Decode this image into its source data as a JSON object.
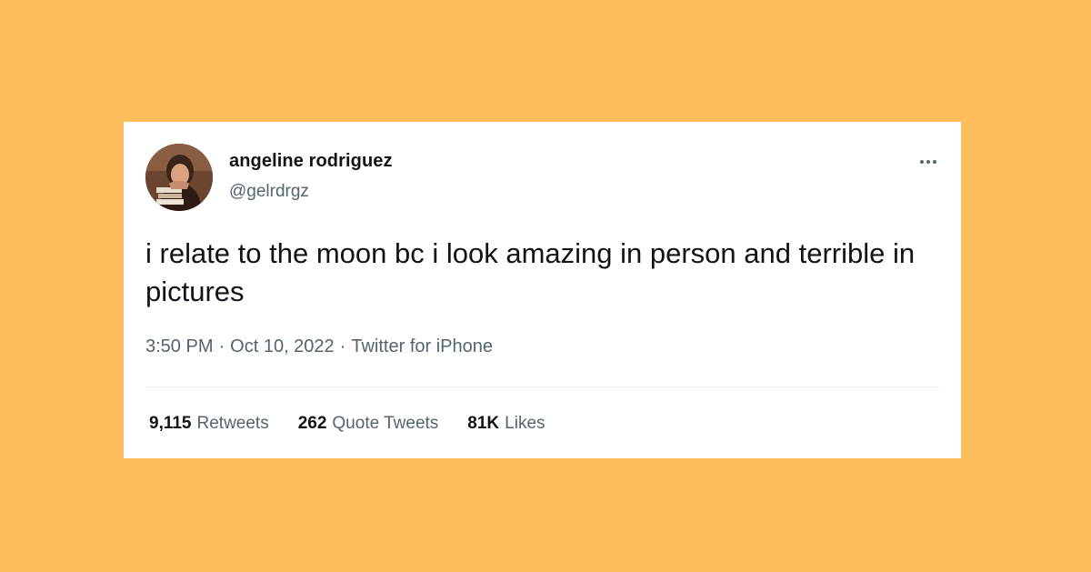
{
  "tweet": {
    "author_name": "angeline rodriguez",
    "author_handle": "@gelrdrgz",
    "text": "i relate to the moon bc i look amazing in person and terrible in pictures",
    "time": "3:50 PM",
    "date": "Oct 10, 2022",
    "source": "Twitter for iPhone",
    "separator": "·"
  },
  "stats": {
    "retweets_count": "9,115",
    "retweets_label": "Retweets",
    "quote_tweets_count": "262",
    "quote_tweets_label": "Quote Tweets",
    "likes_count": "81K",
    "likes_label": "Likes"
  },
  "icons": {
    "more": "more-horizontal-icon"
  },
  "colors": {
    "background": "#fdbd5c",
    "card": "#ffffff",
    "primary_text": "#0f1419",
    "secondary_text": "#536471"
  }
}
